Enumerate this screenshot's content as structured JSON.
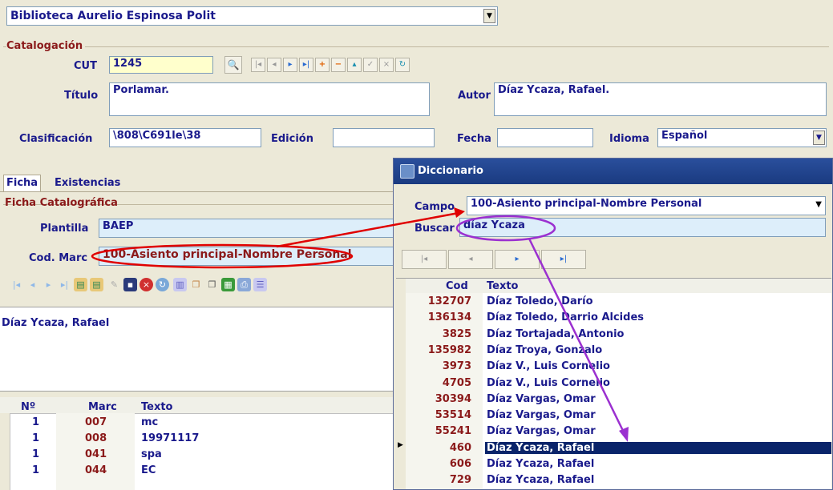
{
  "library": {
    "name": "Biblioteca Aurelio Espinosa Polit"
  },
  "catalog": {
    "group": "Catalogación",
    "cut_label": "CUT",
    "cut_value": "1245",
    "titulo_label": "Título",
    "titulo_value": "Porlamar.",
    "autor_label": "Autor",
    "autor_value": "Díaz Ycaza, Rafael.",
    "clasif_label": "Clasificación",
    "clasif_value": "\\808\\C691le\\38",
    "edicion_label": "Edición",
    "edicion_value": "",
    "fecha_label": "Fecha",
    "fecha_value": "",
    "idioma_label": "Idioma",
    "idioma_value": "Español"
  },
  "tabs": {
    "ficha": "Ficha",
    "existencias": "Existencias"
  },
  "ficha": {
    "group": "Ficha Catalográfica",
    "plantilla_label": "Plantilla",
    "plantilla_value": "BAEP",
    "codmarc_label": "Cod. Marc",
    "codmarc_value": "100-Asiento principal-Nombre Personal",
    "text": "Díaz Ycaza, Rafael",
    "grid": {
      "headers": [
        "Nº",
        "Marc",
        "Texto"
      ],
      "rows": [
        {
          "n": "1",
          "marc": "007",
          "texto": "mc"
        },
        {
          "n": "1",
          "marc": "008",
          "texto": "19971117"
        },
        {
          "n": "1",
          "marc": "041",
          "texto": "spa"
        },
        {
          "n": "1",
          "marc": "044",
          "texto": "EC"
        }
      ]
    }
  },
  "diccionario": {
    "title": "Diccionario",
    "campo_label": "Campo",
    "campo_value": "100-Asiento principal-Nombre Personal",
    "buscar_label": "Buscar",
    "buscar_value": "díaz Ycaza",
    "headers": [
      "Cod",
      "Texto"
    ],
    "rows": [
      {
        "cod": "132707",
        "texto": "Díaz Toledo, Darío"
      },
      {
        "cod": "136134",
        "texto": "Díaz Toledo, Darrio Alcides"
      },
      {
        "cod": "3825",
        "texto": "Díaz Tortajada, Antonio"
      },
      {
        "cod": "135982",
        "texto": "Díaz Troya, Gonzalo"
      },
      {
        "cod": "3973",
        "texto": "Díaz V., Luis Cornelio"
      },
      {
        "cod": "4705",
        "texto": "Díaz V., Luis Cornelio"
      },
      {
        "cod": "30394",
        "texto": "Díaz Vargas, Omar"
      },
      {
        "cod": "53514",
        "texto": "Díaz Vargas, Omar"
      },
      {
        "cod": "55241",
        "texto": "Díaz Vargas, Omar"
      },
      {
        "cod": "460",
        "texto": "Díaz Ycaza, Rafael",
        "selected": true
      },
      {
        "cod": "606",
        "texto": "Díaz Ycaza, Rafael"
      },
      {
        "cod": "729",
        "texto": "Díaz Ycaza, Rafael"
      }
    ]
  },
  "colors": {
    "accent": "#1a1a8c",
    "maroon": "#8b1a1a",
    "selected": "#0a246a",
    "annot_red": "#e00000",
    "annot_purple": "#9b30d0"
  }
}
